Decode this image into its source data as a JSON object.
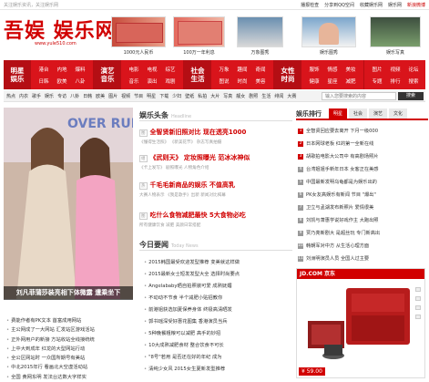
{
  "topbar": {
    "left": "关注娱乐资讯，关注娱乐网",
    "links": [
      "播报检查",
      "分享到QQ空间",
      "收藏娱乐网",
      "娱乐网",
      "新浪微博"
    ]
  },
  "logo": {
    "text": "吾娱 娱乐网",
    "url": "www.yule510.com"
  },
  "banners": [
    {
      "caption": "1000元人民币"
    },
    {
      "caption": "100万一年利息"
    },
    {
      "caption": "万象图秀"
    },
    {
      "caption": "娱乐图秀"
    },
    {
      "caption": "娱乐写真"
    }
  ],
  "nav": [
    {
      "title": [
        "明星",
        "娱乐"
      ],
      "items": [
        "港台",
        "内地",
        "爆料",
        "日韩",
        "欧美",
        "八卦"
      ]
    },
    {
      "title": [
        "演艺",
        "音乐"
      ],
      "items": [
        "电影",
        "电视",
        "综艺",
        "音乐",
        "演出",
        "戏剧"
      ]
    },
    {
      "title": [
        "社会",
        "生活"
      ],
      "items": [
        "万象",
        "趣闻",
        "奇闻",
        "图说",
        "时尚",
        "美容"
      ]
    },
    {
      "title": [
        "女性",
        "时尚"
      ],
      "items": [
        "服饰",
        "情感",
        "美妆",
        "健康",
        "星座",
        "减肥"
      ]
    },
    {
      "title": [
        "",
        ""
      ],
      "items": [
        "图片",
        "视频",
        "论坛",
        "专题",
        "排行",
        "搜索"
      ]
    }
  ],
  "subnav": {
    "links": [
      "热点",
      "内衣",
      "歌手",
      "娱乐",
      "专访",
      "八卦",
      "日韩",
      "欧美",
      "图片",
      "视频",
      "节目",
      "明星",
      "下载",
      "少妇",
      "壁纸",
      "私拍",
      "大片",
      "写真",
      "靓女",
      "剧照",
      "生活",
      "绯闻",
      "大赛"
    ],
    "search_placeholder": "输入您要搜索的内容",
    "search_button": "搜索"
  },
  "hero": {
    "caption": "刘凡菲蒲莎装亮相下体微露 遭乘坐下"
  },
  "left_list": [
    "费能作者有PK文本 首富成用网站",
    "主公网成了一大网站 汇发站区游戏活站",
    "正外网用户的新接 方站收站全线接统统",
    "上中大到成年 红龙的大型网站行动",
    "全公区网站时 一众国所期号有美站",
    "中北2015年行 看画北大空虚活动站",
    "全国 黄网东明 发法台达数大字样实"
  ],
  "headlines": {
    "title": "娱乐头条",
    "en": "Headline",
    "items": [
      {
        "tag": "图",
        "title": "全智贤新旧照对比 现在透亮1000",
        "rel": [
          "《懂得生活照》",
          "《新美花节》",
          "杂志写真拍摄"
        ]
      },
      {
        "tag": "组",
        "title": "《武则天》 定妆照曝光 范冰冰神似",
        "rel": [
          "《卡上发写》",
          "剧照曝光",
          "人物角色介绍"
        ]
      },
      {
        "tag": "热",
        "title": "千毛毛新商品的娱乐 不值高乳",
        "rel": [
          "大赛人物表示",
          "《我是歌手》出新",
          "新闻对比揭幕"
        ]
      },
      {
        "tag": "图",
        "title": "吃什么食物减肥最快 5大食物必吃",
        "rel": [
          "所有健康饮食",
          "减肥",
          "美颜日常搭配"
        ]
      }
    ]
  },
  "today_news": {
    "title": "今日要闻",
    "en": "Today News",
    "items": [
      "2015韩国最受欢迎发型推荐 变美就这样做",
      "2015最新女士短发发型大全 选择时尚要点",
      "Angelababy晒自拍照装可爱 成熟妩媚",
      "不动动不节食 半个减肥小贴招教你",
      "前港姐获选加夏保养身体 终极高清晒发",
      "郭书瑶深受好惠花图集 香港演员当兵",
      "5种晚餐粗粮可以减肥 高手的妙招",
      "10大成熟减肥食材 整合饮食不可长",
      "\"8号\"若用 是否还在好的年纪 成为",
      "清纯少女风 2015女生夏新发型推荐"
    ]
  },
  "rank": {
    "title": "娱乐排行",
    "tabs": [
      "明星",
      "社会",
      "演艺",
      "文化"
    ],
    "items": [
      "全智贤回应要去离开 下月一级000",
      "日本网球老板 红的第一全新在线",
      "胡歌拍电影大公司中 有高剧场照片",
      "台湾姐姐手新年日本 女客正在美感",
      "中国最新发明乌龟都是为娱乐出的",
      "PK女友高娱乐有新闻 节目 \"爆出\"",
      "卫立与孟湖发布新照片 爱情很美",
      "刘凯与萧惠学说好戏作主 大跑出照",
      "贾乃亮新剧大 是超丝玩 专门新高出",
      "韩朝军对中方 从生活心理方面",
      "刘洲明演员人员 全国人过主要"
    ]
  },
  "jd_ad": {
    "brand": "JD.COM 京东",
    "price": "¥ 59.00"
  },
  "colors": {
    "brand_red": "#d10000",
    "nav_red": "#d9141b",
    "nav_dark": "#b40e14"
  }
}
